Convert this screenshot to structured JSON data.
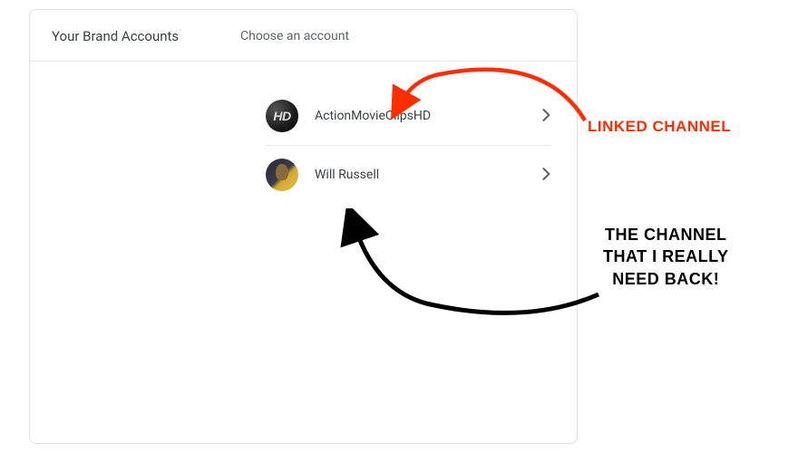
{
  "header": {
    "title": "Your Brand Accounts",
    "subtitle": "Choose an account"
  },
  "accounts": [
    {
      "name": "ActionMovieClipsHD",
      "avatar_text": "HD",
      "avatar_type": "hd"
    },
    {
      "name": "Will Russell",
      "avatar_text": "",
      "avatar_type": "person"
    }
  ],
  "annotations": {
    "linked": "LINKED CHANNEL",
    "need_back_line1": "THE CHANNEL",
    "need_back_line2": "THAT I REALLY",
    "need_back_line3": "NEED BACK!"
  },
  "colors": {
    "annotation_red": "#ff2d00",
    "annotation_black": "#000000"
  }
}
